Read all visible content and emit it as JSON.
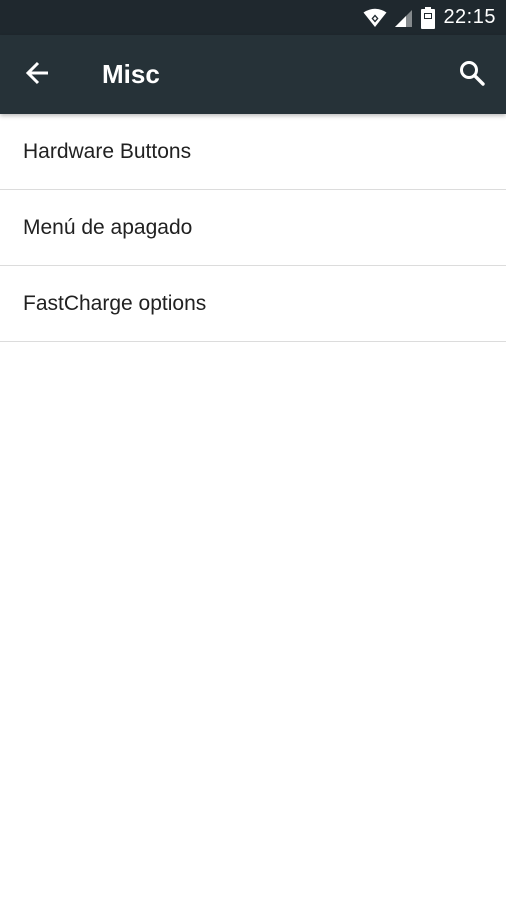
{
  "status_bar": {
    "time": "22:15",
    "icons": [
      "wifi-icon",
      "signal-icon",
      "battery-icon"
    ],
    "background": "#1f282e"
  },
  "toolbar": {
    "title": "Misc",
    "back_icon": "arrow-back-icon",
    "search_icon": "search-icon",
    "background": "#263238"
  },
  "settings": {
    "items": [
      {
        "label": "Hardware Buttons"
      },
      {
        "label": "Menú de apagado"
      },
      {
        "label": "FastCharge options"
      }
    ]
  }
}
